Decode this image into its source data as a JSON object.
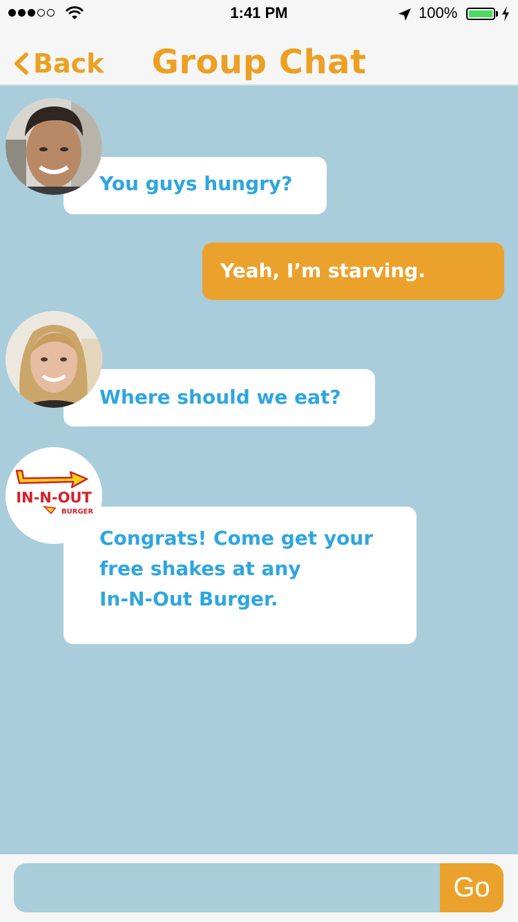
{
  "status_bar": {
    "time": "1:41 PM",
    "battery": "100%",
    "signal_bars_filled": 3,
    "signal_bars_total": 5
  },
  "nav": {
    "back_label": "Back",
    "title": "Group Chat"
  },
  "messages": [
    {
      "sender": "friend-1",
      "direction": "incoming",
      "text": "You guys hungry?"
    },
    {
      "sender": "me",
      "direction": "outgoing",
      "text": "Yeah, I’m starving."
    },
    {
      "sender": "friend-2",
      "direction": "incoming",
      "text": "Where should we eat?"
    },
    {
      "sender": "in-n-out",
      "direction": "incoming",
      "lines": [
        "Congrats! Come get your",
        "free shakes at any",
        "In-N-Out Burger."
      ],
      "logo_text": "IN-N-OUT",
      "logo_subtext": "BURGER"
    }
  ],
  "composer": {
    "value": "",
    "send_label": "Go"
  },
  "colors": {
    "accent": "#eca023",
    "chat_background": "#a9cddb",
    "incoming_text": "#2ea6df",
    "outgoing_bubble": "#eaa22c",
    "logo_red": "#d4202a",
    "logo_yellow": "#f7d417"
  }
}
